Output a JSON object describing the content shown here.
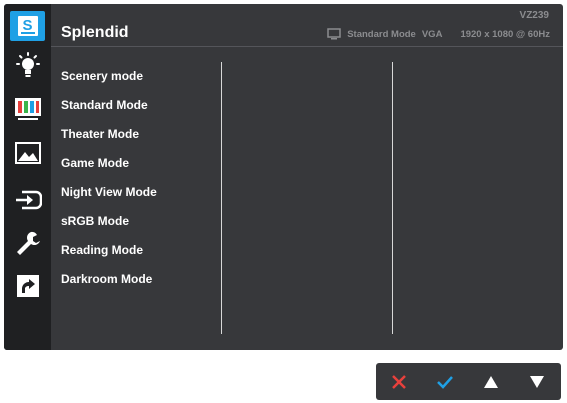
{
  "header": {
    "title": "Splendid",
    "model": "VZ239",
    "status": {
      "mode": "Standard Mode",
      "input": "VGA",
      "resolution": "1920 x 1080 @ 60Hz"
    }
  },
  "menu": {
    "items": [
      "Scenery mode",
      "Standard Mode",
      "Theater Mode",
      "Game Mode",
      "Night View Mode",
      "sRGB Mode",
      "Reading Mode",
      "Darkroom Mode"
    ]
  },
  "sidebar": {
    "logo_letter": "S",
    "icons": [
      "splendid-icon",
      "brightness-icon",
      "color-icon",
      "image-icon",
      "input-select-icon",
      "system-setup-icon",
      "shortcut-icon"
    ]
  },
  "keys": [
    "close-icon",
    "check-icon",
    "arrow-up-icon",
    "arrow-down-icon"
  ],
  "colors": {
    "accent": "#1fa0e5",
    "panel": "#37383b",
    "sidebar": "#1f2022",
    "close": "#e8403c",
    "check": "#1fa0e5"
  }
}
